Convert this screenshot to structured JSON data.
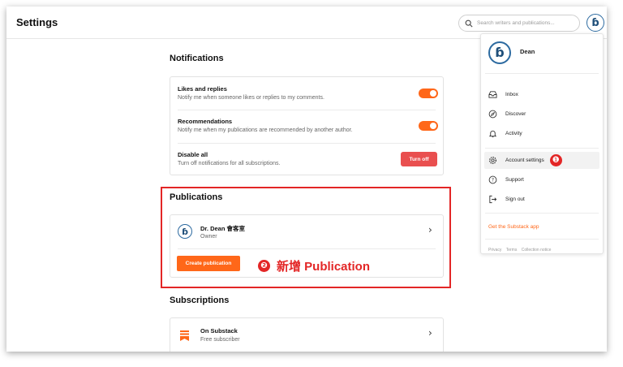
{
  "header": {
    "title": "Settings",
    "search_placeholder": "Search writers and publications..."
  },
  "notifications": {
    "title": "Notifications",
    "items": [
      {
        "title": "Likes and replies",
        "desc": "Notify me when someone likes or replies to my comments.",
        "enabled": true
      },
      {
        "title": "Recommendations",
        "desc": "Notify me when my publications are recommended by another author.",
        "enabled": true
      },
      {
        "title": "Disable all",
        "desc": "Turn off notifications for all subscriptions.",
        "button": "Turn off"
      }
    ]
  },
  "publications": {
    "title": "Publications",
    "item": {
      "name": "Dr. Dean 會客室",
      "role": "Owner"
    },
    "create_button": "Create publication"
  },
  "subscriptions": {
    "title": "Subscriptions",
    "item": {
      "name": "On Substack",
      "role": "Free subscriber"
    }
  },
  "menu": {
    "user_name": "Dean",
    "items": [
      {
        "label": "Inbox",
        "icon": "inbox-icon"
      },
      {
        "label": "Discover",
        "icon": "compass-icon"
      },
      {
        "label": "Activity",
        "icon": "bell-icon"
      },
      {
        "label": "Account settings",
        "icon": "gear-icon"
      },
      {
        "label": "Support",
        "icon": "help-icon"
      },
      {
        "label": "Sign out",
        "icon": "sign-out-icon"
      }
    ],
    "app_link": "Get the Substack app",
    "footer": [
      "Privacy",
      "Terms",
      "Collection notice"
    ]
  },
  "annotations": {
    "step1": "❶",
    "step2": "❷",
    "step2_text": "新增 Publication"
  },
  "colors": {
    "accent": "#ff6719",
    "danger": "#e94f4f",
    "annotation": "#e32626",
    "logo": "#2c6aa0"
  }
}
